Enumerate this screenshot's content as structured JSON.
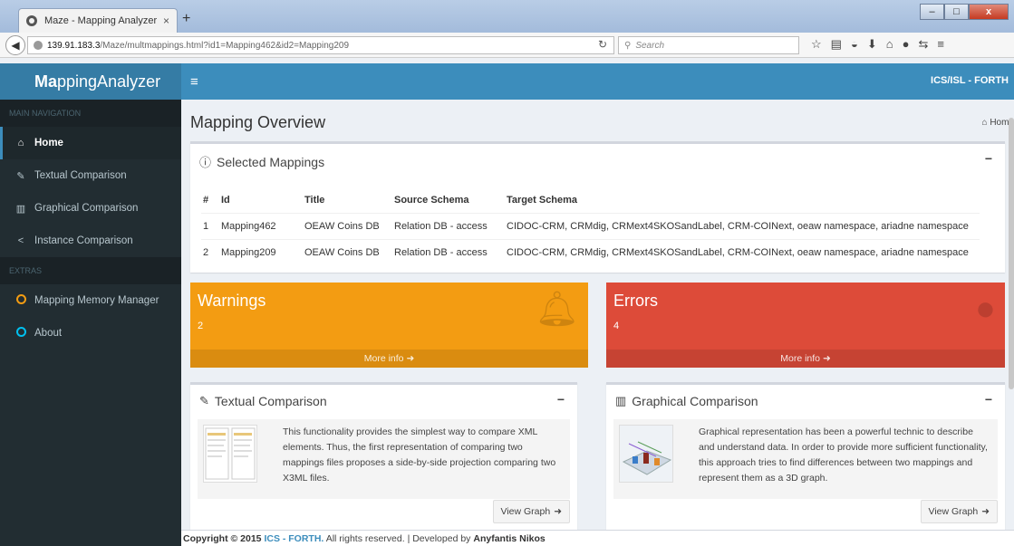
{
  "browser": {
    "tab_title": "Maze - Mapping Analyzer",
    "tab_close": "×",
    "new_tab": "+",
    "url_host": "139.91.183.3",
    "url_path": "/Maze/multmappings.html?id1=Mapping462&id2=Mapping209",
    "search_placeholder": "Search",
    "window_buttons": {
      "minimize": "–",
      "maximize": "□",
      "close": "x"
    }
  },
  "app": {
    "logo_bold": "Ma",
    "logo_rest": "ppingAnalyzer",
    "org": "ICS/ISL - FORTH"
  },
  "sidebar": {
    "main_header": "MAIN NAVIGATION",
    "items": [
      {
        "label": "Home",
        "icon": "home-icon"
      },
      {
        "label": "Textual Comparison",
        "icon": "pencil-icon"
      },
      {
        "label": "Graphical Comparison",
        "icon": "bar-chart-icon"
      },
      {
        "label": "Instance Comparison",
        "icon": "share-icon"
      }
    ],
    "extras_header": "EXTRAS",
    "extras": [
      {
        "label": "Mapping Memory Manager",
        "icon": "circle-icon",
        "color": "#f39c12"
      },
      {
        "label": "About",
        "icon": "circle-icon",
        "color": "#00c0ef"
      }
    ]
  },
  "page": {
    "title": "Mapping Overview",
    "breadcrumb": "Home"
  },
  "selected_mappings": {
    "title": "Selected Mappings",
    "columns": [
      "#",
      "Id",
      "Title",
      "Source Schema",
      "Target Schema"
    ],
    "rows": [
      [
        "1",
        "Mapping462",
        "OEAW Coins DB",
        "Relation DB - access",
        "CIDOC-CRM, CRMdig, CRMext4SKOSandLabel, CRM-COINext, oeaw namespace, ariadne namespace"
      ],
      [
        "2",
        "Mapping209",
        "OEAW Coins DB",
        "Relation DB - access",
        "CIDOC-CRM, CRMdig, CRMext4SKOSandLabel, CRM-COINext, oeaw namespace, ariadne namespace"
      ]
    ]
  },
  "warnings": {
    "title": "Warnings",
    "count": "2",
    "footer": "More info",
    "color": "#f39c12"
  },
  "errors": {
    "title": "Errors",
    "count": "4",
    "footer": "More info",
    "color": "#dd4b39"
  },
  "textual": {
    "title": "Textual Comparison",
    "text": "This functionality provides the simplest way to compare XML elements. Thus, the first representation of comparing two mappings files proposes a side-by-side projection comparing two X3ML files.",
    "button": "View Graph"
  },
  "graphical": {
    "title": "Graphical Comparison",
    "text": "Graphical representation has been a powerful technic to describe and understand data. In order to provide more sufficient functionality, this approach tries to find differences between two mappings and represent them as a 3D graph.",
    "button": "View Graph"
  },
  "footer": {
    "prefix": "Copyright © 2015",
    "org": "ICS - FORTH.",
    "middle": "All rights reserved. | Developed by",
    "author": "Anyfantis Nikos"
  }
}
